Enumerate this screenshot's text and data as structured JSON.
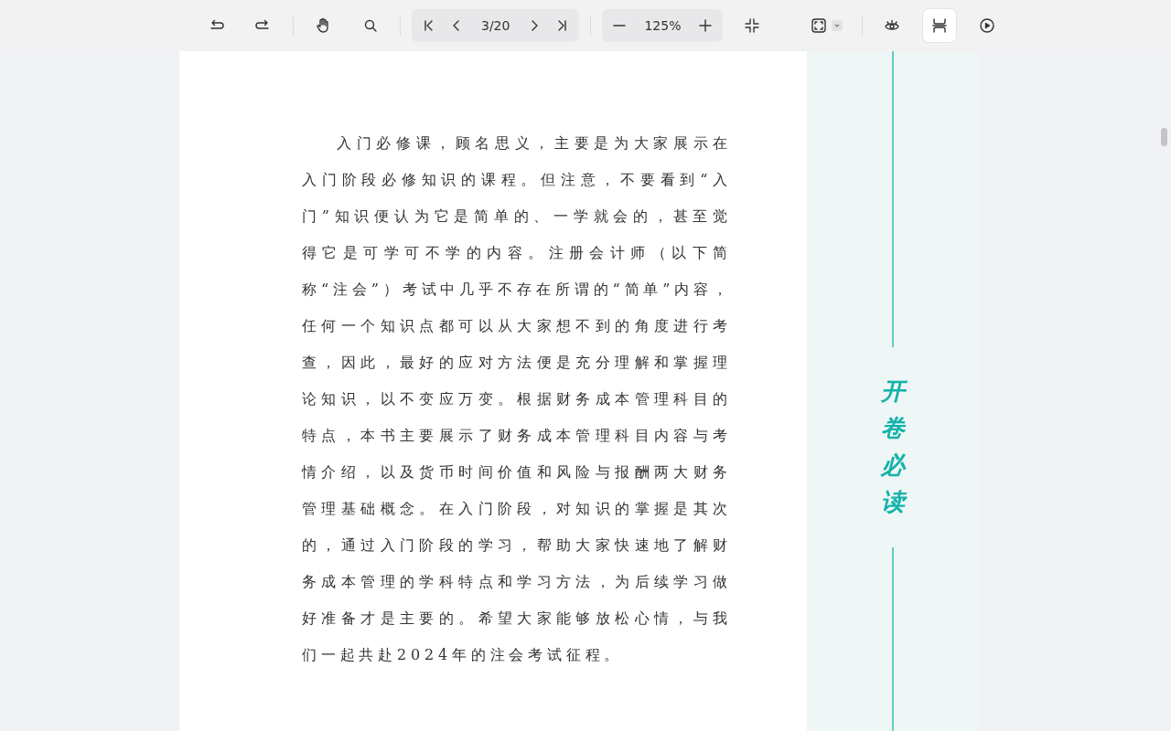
{
  "toolbar": {
    "tools": [
      {
        "kind": "undo",
        "selected": false
      },
      {
        "kind": "redo",
        "selected": false
      },
      {
        "kind": "hand",
        "selected": false
      },
      {
        "kind": "search",
        "selected": false
      }
    ],
    "pager": {
      "page": "3/20"
    },
    "zoom": {
      "value": "125%"
    },
    "view_tools": [
      {
        "kind": "fit",
        "selected": false
      },
      {
        "kind": "fullscreen",
        "selected": false
      },
      {
        "kind": "eye",
        "selected": false
      },
      {
        "kind": "scroll-mode",
        "selected": true
      },
      {
        "kind": "play",
        "selected": false
      }
    ]
  },
  "page": {
    "paragraph": "入门必修课，顾名思义，主要是为大家展示在入门阶段必修知识的课程。但注意，不要看到“入门”知识便认为它是简单的、一学就会的，甚至觉得它是可学可不学的内容。注册会计师（以下简称“注会”）考试中几乎不存在所谓的“简单”内容，任何一个知识点都可以从大家想不到的角度进行考查，因此，最好的应对方法便是充分理解和掌握理论知识，以不变应万变。根据财务成本管理科目的特点，本书主要展示了财务成本管理科目内容与考情介绍，以及货币时间价值和风险与报酬两大财务管理基础概念。在入门阶段，对知识的掌握是其次的，通过入门阶段的学习，帮助大家快速地了解财务成本管理的学科特点和学习方法，为后续学习做好准备才是主要的。希望大家能够放松心情，与我们一起共赴2024年的注会考试征程。",
    "side_heading": "开卷必读"
  }
}
